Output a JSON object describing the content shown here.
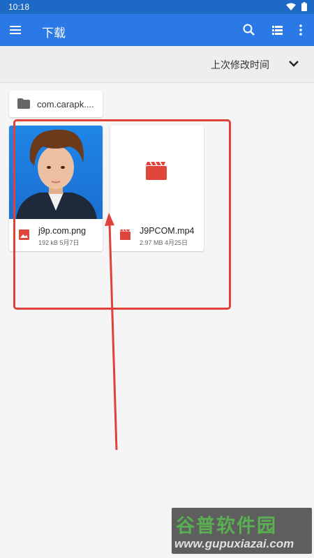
{
  "status_bar": {
    "time": "10:18",
    "icons": [
      "wifi-icon",
      "battery-icon"
    ]
  },
  "app_bar": {
    "title": "下载",
    "actions": [
      "search-icon",
      "list-view-icon",
      "more-icon"
    ],
    "background": "#2a79e6"
  },
  "sort_bar": {
    "label": "上次修改时间"
  },
  "folders": [
    {
      "name": "com.carapk...."
    }
  ],
  "files": [
    {
      "name": "j9p.com.png",
      "meta": "192 kB 5月7日",
      "type": "image"
    },
    {
      "name": "J9PCOM.mp4",
      "meta": "2.97 MB 4月25日",
      "type": "video"
    }
  ],
  "watermark": {
    "brand": "谷普软件园",
    "url": "www.gupuxiazai.com"
  },
  "annotation_color": "#e0413a"
}
